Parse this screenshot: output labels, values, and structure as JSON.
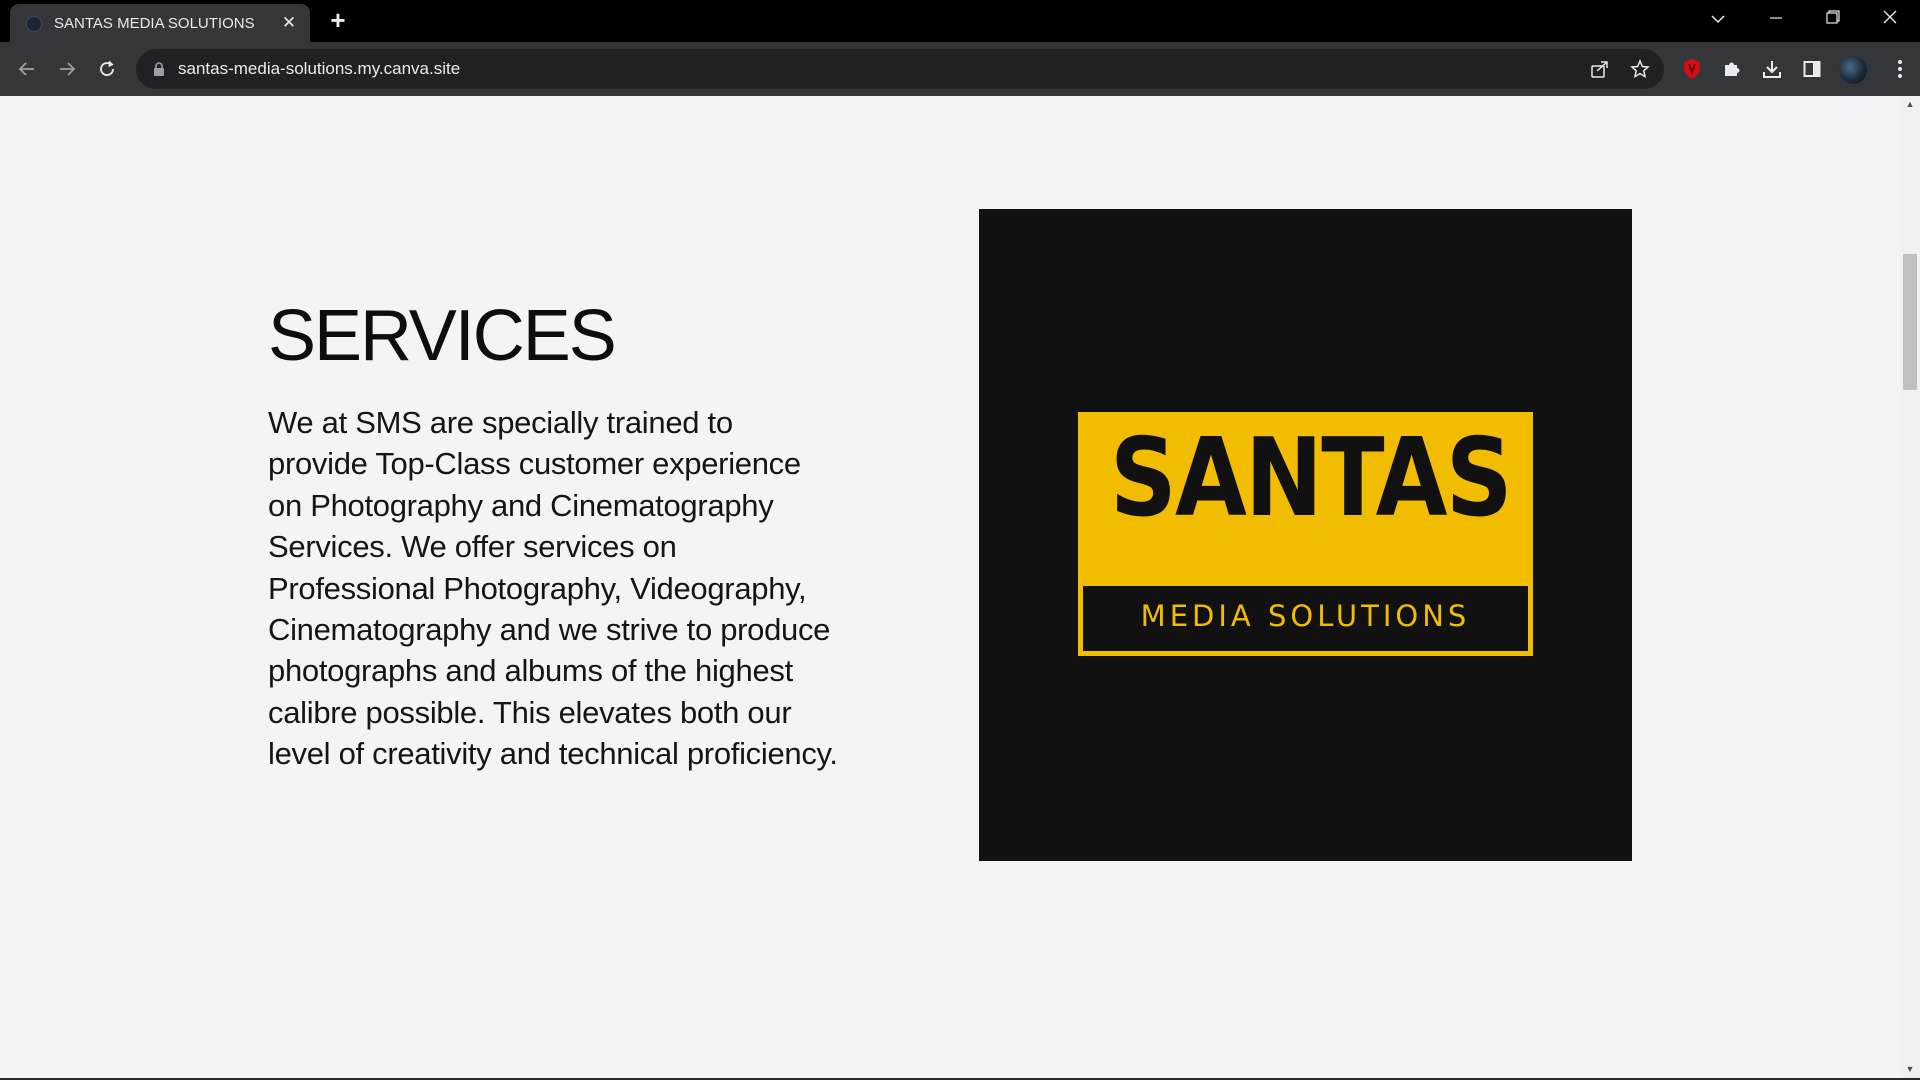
{
  "browser": {
    "tab_title": "SANTAS MEDIA SOLUTIONS",
    "tab_close": "✕",
    "new_tab": "+",
    "window": {
      "tab_search": "⌄",
      "minimize": "─",
      "maximize": "❐",
      "close": "✕"
    },
    "url": "santas-media-solutions.my.canva.site"
  },
  "page": {
    "services_title": "SERVICES",
    "services_body": "We at SMS are specially trained to provide Top-Class customer experience on Photography and Cinematography Services. We offer services on Professional Photography, Videography, Cinematography and we strive to produce photographs and albums of the highest calibre possible. This elevates both our level of creativity and technical proficiency.",
    "logo": {
      "main_text": "SANTAS",
      "sub_text": "MEDIA SOLUTIONS"
    }
  },
  "scrollbar": {
    "up_arrow": "▲",
    "down_arrow": "▼",
    "scroll_position": 0.18
  },
  "colors": {
    "page_background": "#f2f5f7",
    "logo_yellow": "#f2bc00",
    "logo_black": "#111111",
    "chrome_dark": "#35363a"
  }
}
